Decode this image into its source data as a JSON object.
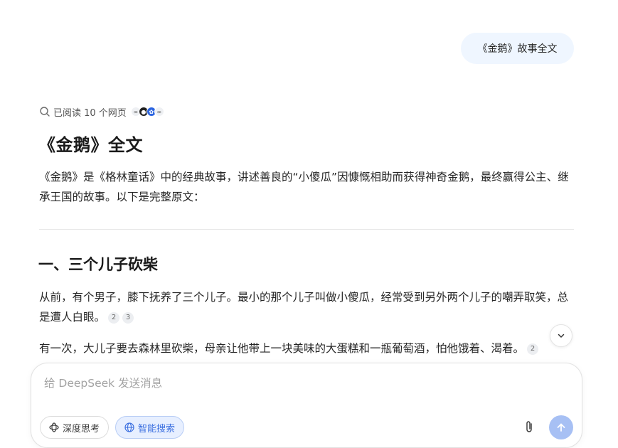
{
  "user_message": "《金鹅》故事全文",
  "search_status": {
    "label": "已阅读 10 个网页",
    "icons": [
      "link-icon",
      "logo-icon",
      "paw-icon",
      "link-icon"
    ]
  },
  "answer": {
    "title": "《金鹅》全文",
    "intro": "《金鹅》是《格林童话》中的经典故事，讲述善良的“小傻瓜”因慷慨相助而获得神奇金鹅，最终赢得公主、继承王国的故事。以下是完整原文：",
    "section1": {
      "heading": "一、三个儿子砍柴",
      "para1": "从前，有个男子，膝下抚养了三个儿子。最小的那个儿子叫做小傻瓜，经常受到另外两个儿子的嘲弄取笑，总是遭人白眼。",
      "para1_cites": [
        "2",
        "3"
      ],
      "para2": "有一次，大儿子要去森林里砍柴，母亲让他带上一块美味的大蛋糕和一瓶葡萄酒，怕他饿着、渴着。",
      "para2_cites": [
        "2"
      ]
    }
  },
  "composer": {
    "placeholder": "给 DeepSeek 发送消息",
    "deep_think_label": "深度思考",
    "web_search_label": "智能搜索"
  },
  "colors": {
    "accent": "#4d6bfe",
    "bubble": "#eff6ff",
    "send_disabled": "#a7c0f4"
  }
}
